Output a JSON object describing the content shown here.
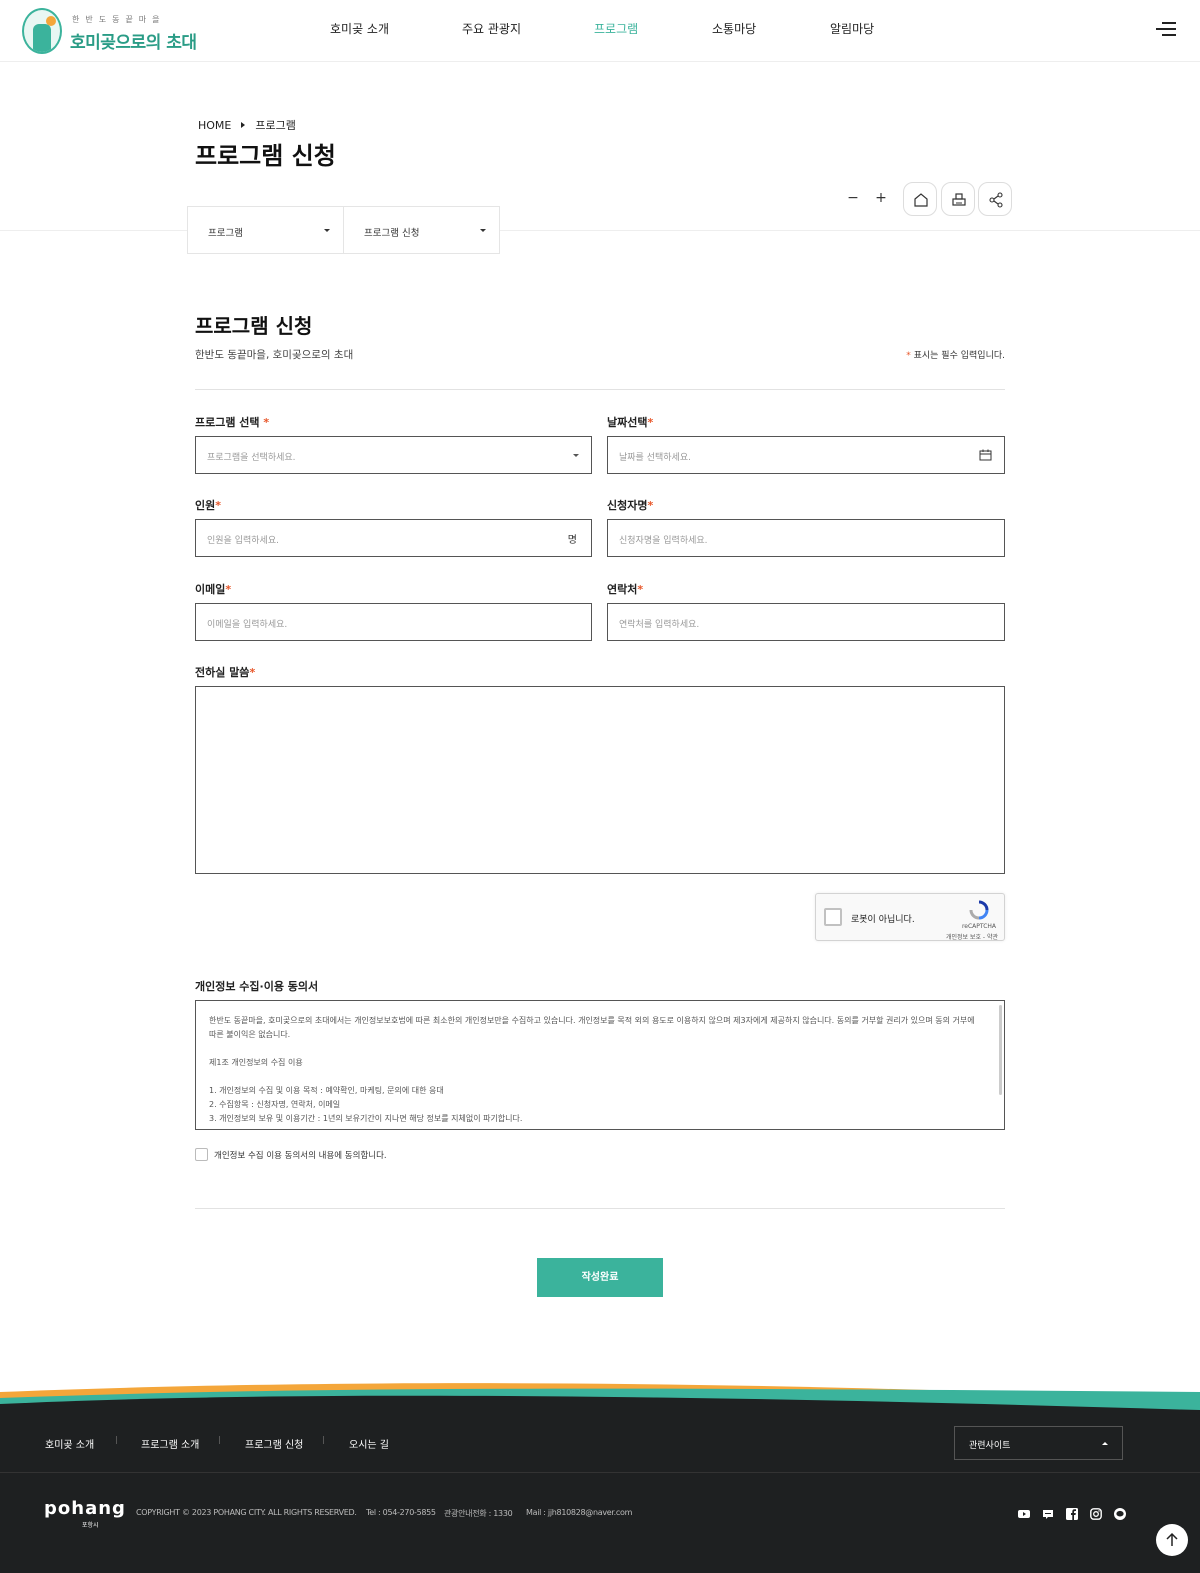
{
  "header": {
    "logo_sub": "한반도동끝마을",
    "logo_main": "호미곶으로의 초대",
    "nav": [
      "호미곶 소개",
      "주요 관광지",
      "프로그램",
      "소통마당",
      "알림마당"
    ],
    "active_nav": "프로그램"
  },
  "breadcrumb": {
    "home": "HOME",
    "current": "프로그램"
  },
  "page_title": "프로그램 신청",
  "tools": {
    "zoom_out": "−",
    "zoom_in": "+"
  },
  "snb": {
    "depth1": "프로그램",
    "depth2": "프로그램 신청"
  },
  "form": {
    "title": "프로그램 신청",
    "subtitle": "한반도 동끝마을, 호미곶으로의 초대",
    "required_star": "*",
    "required_note": "표시는 필수 입력입니다.",
    "program": {
      "label": "프로그램 선택",
      "placeholder": "프로그램을 선택하세요."
    },
    "date": {
      "label": "날짜선택",
      "placeholder": "날짜를 선택하세요."
    },
    "people": {
      "label": "인원",
      "placeholder": "인원을 입력하세요.",
      "unit": "명"
    },
    "name": {
      "label": "신청자명",
      "placeholder": "신청자명을 입력하세요."
    },
    "email": {
      "label": "이메일",
      "placeholder": "이메일을 입력하세요."
    },
    "phone": {
      "label": "연락처",
      "placeholder": "연락처를 입력하세요."
    },
    "message": {
      "label": "전하실 말씀"
    }
  },
  "recaptcha": {
    "text": "로봇이 아닙니다.",
    "brand": "reCAPTCHA",
    "terms": "개인정보 보호 - 약관"
  },
  "privacy": {
    "title": "개인정보 수집·이용 동의서",
    "intro": "한반도 동끝마을, 호미곶으로의 초대에서는 개인정보보호법에 따른 최소한의 개인정보만을 수집하고 있습니다. 개인정보를 목적 외의 용도로 이용하지 않으며 제3자에게 제공하지 않습니다. 동의를 거부할 권리가 있으며 동의 거부에 따른 불이익은 없습니다.",
    "article": "제1조 개인정보의 수집 이용",
    "items": [
      "1. 개인정보의 수집 및 이용 목적 : 예약확인, 마케팅, 문의에 대한 응대",
      "2. 수집항목 : 신청자명, 연락처, 이메일",
      "3. 개인정보의 보유 및 이용기간 : 1년의 보유기간이 지나면 해당 정보를 지체없이 파기합니다."
    ],
    "agree_label": "개인정보 수집 이용 동의서의 내용에 동의합니다."
  },
  "submit_label": "작성완료",
  "footer": {
    "nav": [
      "호미곶 소개",
      "프로그램 소개",
      "프로그램 신청",
      "오시는 길"
    ],
    "related_label": "관련사이트",
    "logo": "pohang",
    "logo_sub": "포항시",
    "copyright": "COPYRIGHT © 2023 POHANG CITY. ALL RIGHTS RESERVED.",
    "tel": "Tel : 054-270-5855",
    "tour_tel": "관광안내전화 : 1330",
    "mail": "Mail : jjh810828@naver.com"
  },
  "colors": {
    "accent": "#3bb39c",
    "required": "#e8572a",
    "footer_bg": "#1e2021",
    "wave_orange": "#f4a63a",
    "wave_teal": "#2a8f7a"
  }
}
